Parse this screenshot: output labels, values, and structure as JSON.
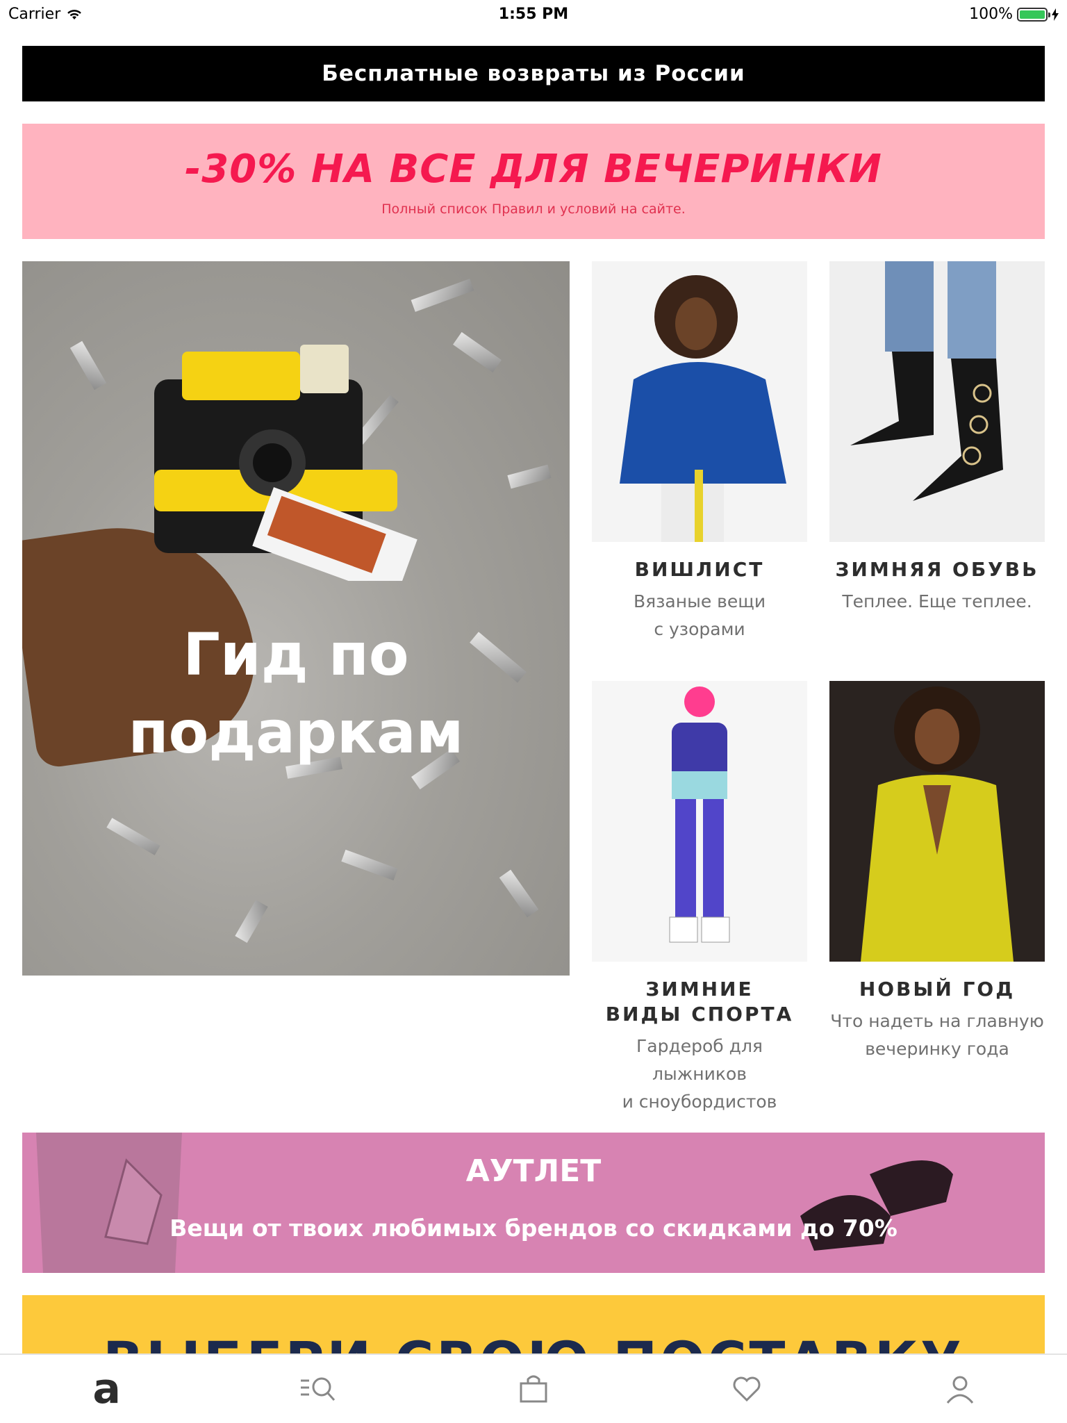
{
  "status_bar": {
    "carrier": "Carrier",
    "time": "1:55 PM",
    "battery": "100%"
  },
  "returns_banner": "Бесплатные возвраты из России",
  "promo": {
    "title": "-30% НА ВСЕ ДЛЯ ВЕЧЕРИНКИ",
    "subtitle": "Полный список Правил и условий на сайте."
  },
  "hero": {
    "title_line1": "Гид по",
    "title_line2": "подаркам"
  },
  "tiles": [
    {
      "label": "ВИШЛИСТ",
      "sub_line1": "Вязаные вещи",
      "sub_line2": "с узорами"
    },
    {
      "label": "ЗИМНЯЯ ОБУВЬ",
      "sub_line1": "Теплее. Еще теплее.",
      "sub_line2": ""
    },
    {
      "label_line1": "ЗИМНИЕ",
      "label_line2": "ВИДЫ СПОРТА",
      "sub_line1": "Гардероб для лыжников",
      "sub_line2": "и сноубордистов"
    },
    {
      "label": "НОВЫЙ ГОД",
      "sub_line1": "Что надеть на главную",
      "sub_line2": "вечеринку года"
    }
  ],
  "outlet": {
    "title": "АУТЛЕТ",
    "subtitle": "Вещи от твоих любимых брендов со скидками до 70%"
  },
  "delivery": {
    "title": "ВЫБЕРИ СВОЮ ПОСТАВКУ"
  },
  "tab_bar": {
    "items": [
      {
        "icon": "home-logo-icon",
        "glyph": "a"
      },
      {
        "icon": "search-icon"
      },
      {
        "icon": "bag-icon"
      },
      {
        "icon": "heart-icon"
      },
      {
        "icon": "account-icon"
      }
    ]
  }
}
